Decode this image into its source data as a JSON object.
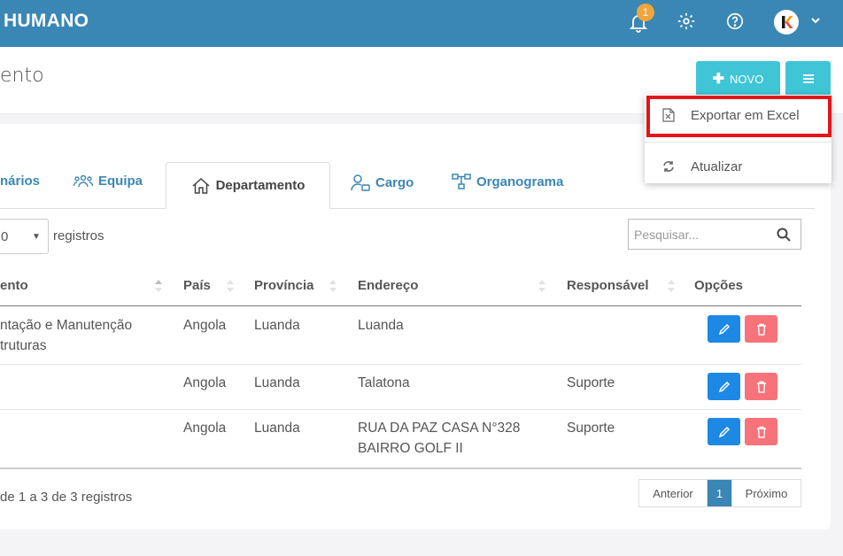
{
  "app": {
    "brand": "HUMANO",
    "notification_count": "1"
  },
  "page": {
    "title": "ento"
  },
  "toolbar": {
    "new_label": "NOVO"
  },
  "dropdown": {
    "items": [
      {
        "label": "Exportar em Excel"
      },
      {
        "label": "Atualizar"
      }
    ]
  },
  "tabs": [
    {
      "label": "nários"
    },
    {
      "label": "Equipa"
    },
    {
      "label": "Departamento",
      "active": true
    },
    {
      "label": "Cargo"
    },
    {
      "label": "Organograma"
    }
  ],
  "table_controls": {
    "page_length": "0",
    "length_suffix": "registros",
    "search_placeholder": "Pesquisar..."
  },
  "table": {
    "columns": [
      "ento",
      "País",
      "Província",
      "Endereço",
      "Responsável",
      "Opções"
    ],
    "rows": [
      {
        "name_line1": "ntação e Manutenção",
        "name_line2": "truturas",
        "pais": "Angola",
        "provincia": "Luanda",
        "endereco_line1": "Luanda",
        "endereco_line2": "",
        "responsavel": ""
      },
      {
        "name_line1": "",
        "name_line2": "",
        "pais": "Angola",
        "provincia": "Luanda",
        "endereco_line1": "Talatona",
        "endereco_line2": "",
        "responsavel": "Suporte"
      },
      {
        "name_line1": "",
        "name_line2": "",
        "pais": "Angola",
        "provincia": "Luanda",
        "endereco_line1": "RUA DA PAZ CASA N°328",
        "endereco_line2": "BAIRRO GOLF II",
        "responsavel": "Suporte"
      }
    ]
  },
  "footer": {
    "info": "de 1 a 3 de 3 registros"
  },
  "pagination": {
    "prev": "Anterior",
    "current": "1",
    "next": "Próximo"
  },
  "colors": {
    "primary": "#3a87b5",
    "teal": "#3fc5d6",
    "edit": "#1e88e5",
    "delete": "#f87379",
    "badge": "#f0a63a",
    "highlight": "#e3151a"
  }
}
